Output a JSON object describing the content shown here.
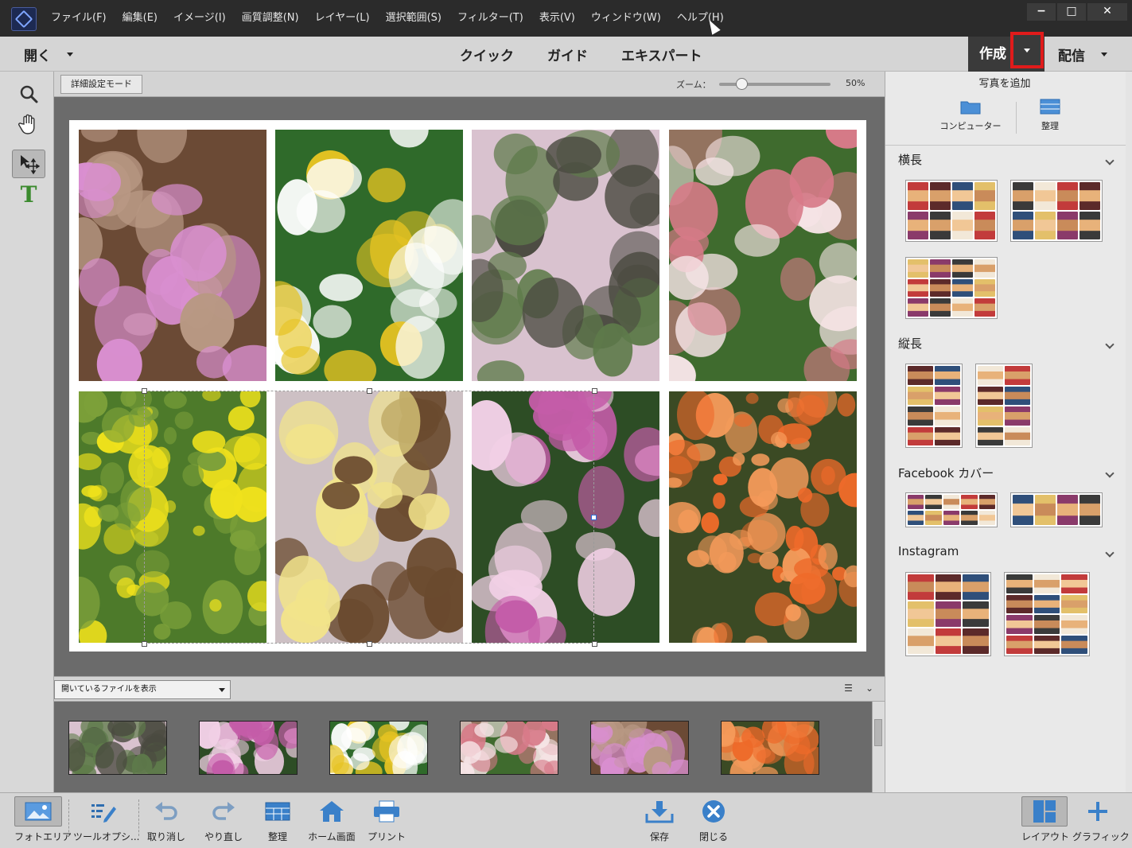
{
  "window": {
    "menu": [
      "ファイル(F)",
      "編集(E)",
      "イメージ(I)",
      "画質調整(N)",
      "レイヤー(L)",
      "選択範囲(S)",
      "フィルター(T)",
      "表示(V)",
      "ウィンドウ(W)",
      "ヘルプ(H)"
    ],
    "controls": {
      "minimize": "−",
      "maximize": "□",
      "close": "✕"
    }
  },
  "modebar": {
    "open_label": "開く",
    "tabs": [
      "クイック",
      "ガイド",
      "エキスパート"
    ],
    "create_label": "作成",
    "share_label": "配信"
  },
  "tools": [
    "zoom-icon",
    "hand-icon",
    "move-icon",
    "type-icon"
  ],
  "type_tool_glyph": "T",
  "options": {
    "mode_button": "詳細設定モード",
    "zoom_label": "ズーム：",
    "zoom_value": "50%",
    "zoom_level": 0.2
  },
  "canvas": {
    "cells": [
      {
        "name": "fawn-lily",
        "colors": [
          "#6b4a35",
          "#d98fd0",
          "#b89884"
        ]
      },
      {
        "name": "daisies",
        "colors": [
          "#2f6a2a",
          "#ffffff",
          "#e6c322"
        ]
      },
      {
        "name": "cherry-tree",
        "colors": [
          "#d9c2cf",
          "#4a4a40",
          "#5e7b4a"
        ]
      },
      {
        "name": "cherry-blossom",
        "colors": [
          "#3f6b2e",
          "#f6e4e6",
          "#d77a88"
        ]
      },
      {
        "name": "rapeseed",
        "colors": [
          "#4d7a2a",
          "#f0e21c",
          "#7ca03a"
        ]
      },
      {
        "name": "wintersweet",
        "colors": [
          "#cdc0c4",
          "#f2e48a",
          "#6a4a2e"
        ]
      },
      {
        "name": "clematis",
        "colors": [
          "#2d4d25",
          "#c45ca8",
          "#f2d0e6"
        ]
      },
      {
        "name": "azalea",
        "colors": [
          "#3b4a24",
          "#ee6a2a",
          "#f49a5a"
        ]
      }
    ]
  },
  "bin": {
    "select_label": "開いているファイルを表示",
    "thumbnails": [
      "cherry-tree",
      "clematis",
      "daisies",
      "cherry-blossom",
      "fawn-lily",
      "azalea"
    ]
  },
  "panel": {
    "add_photo_title": "写真を追加",
    "sources": [
      "コンピューター",
      "整理"
    ],
    "sections": [
      {
        "title": "横長"
      },
      {
        "title": "縦長"
      },
      {
        "title": "Facebook カバー"
      },
      {
        "title": "Instagram"
      }
    ]
  },
  "bottom": {
    "left": [
      "フォトエリア",
      "ツールオプシ...",
      "取り消し",
      "やり直し",
      "整理",
      "ホーム画面",
      "プリント"
    ],
    "center": [
      "保存",
      "閉じる"
    ],
    "right": [
      "レイアウト",
      "グラフィック"
    ]
  },
  "colors": {
    "accent_red": "#e01b1b",
    "dark": "#2b2b2b",
    "panel": "#e9e9e9",
    "canvas": "#6b6b6b"
  }
}
